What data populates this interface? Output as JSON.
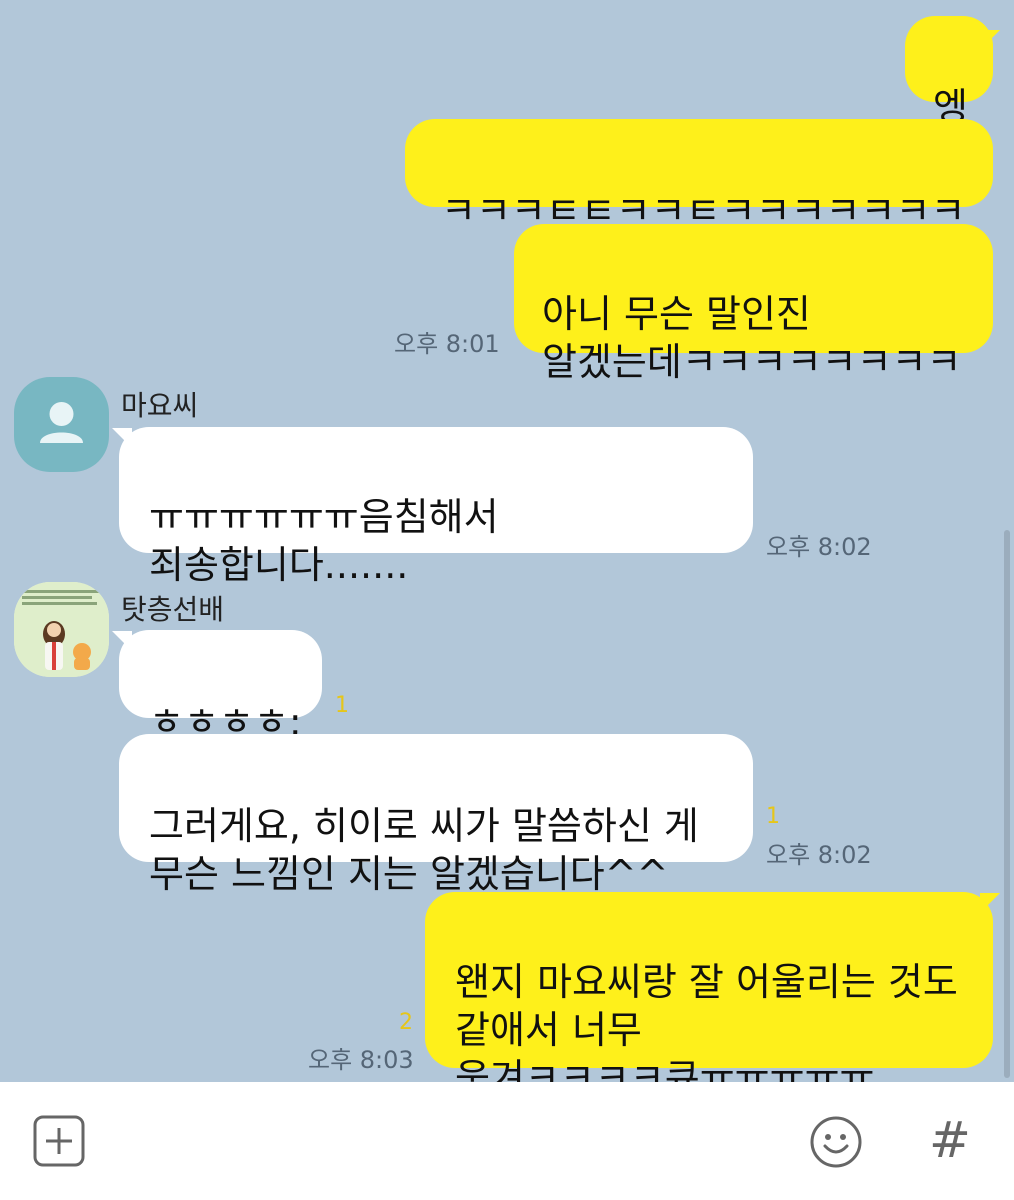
{
  "messages": {
    "m1": {
      "text": "엥"
    },
    "m2": {
      "text": "ㅋㅋㅋㅌㅌㅋㅋㅌㅋㅋㅋㅋㅋㅋㅋ"
    },
    "m3": {
      "text": "아니 무슨 말인진\n알겠는데ㅋㅋㅋㅋㅋㅋㅋㅋ",
      "time": "오후 8:01"
    },
    "m4": {
      "sender": "마요씨",
      "text": "ㅠㅠㅠㅠㅠㅠ음침해서\n죄송합니다.......",
      "time": "오후 8:02"
    },
    "m5": {
      "sender": "탓층선배",
      "text": "ㅎㅎㅎㅎ;",
      "unread": "1"
    },
    "m6": {
      "text": "그러게요, 히이로 씨가 말씀하신 게\n무슨 느낌인 지는 알겠습니다^^",
      "unread": "1",
      "time": "오후 8:02"
    },
    "m7": {
      "text": "왠지 마요씨랑 잘 어울리는 것도\n같애서 너무\n웃겨ㅋㅋㅋㅋ큐ㅠㅠㅠㅠㅠ",
      "unread": "2",
      "time": "오후 8:03"
    }
  },
  "input_bar": {
    "add_icon": "plus-square-icon",
    "emoji_icon": "smiley-icon",
    "hash_icon": "hash-icon",
    "hash_glyph": "#"
  },
  "colors": {
    "background": "#b2c7d9",
    "my_bubble": "#fef01b",
    "other_bubble": "#ffffff",
    "unread": "#e6c619"
  }
}
